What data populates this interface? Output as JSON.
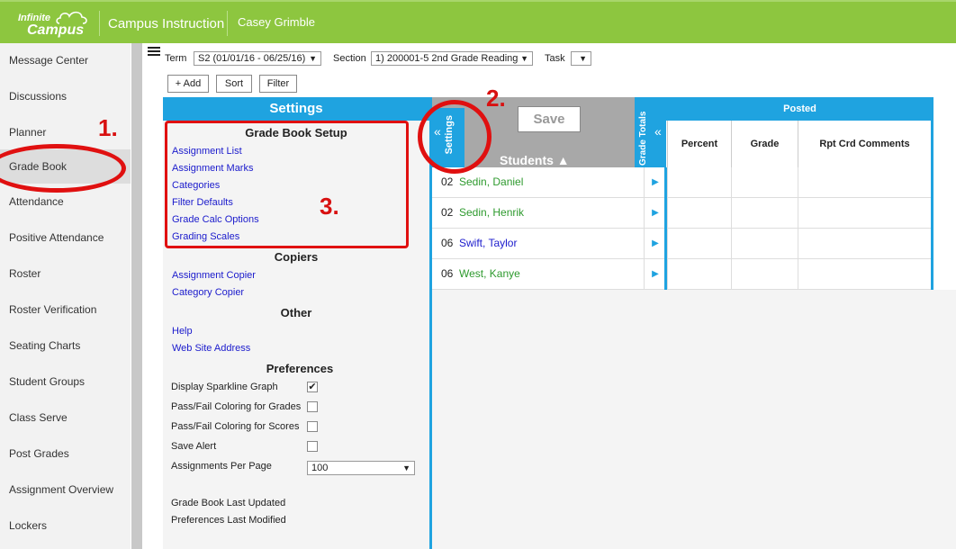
{
  "app": {
    "brand_line1": "Infinite",
    "brand_line2": "Campus",
    "title": "Campus Instruction",
    "user": "Casey Grimble"
  },
  "sidebar": {
    "items": [
      {
        "label": "Message Center"
      },
      {
        "label": "Discussions"
      },
      {
        "label": "Planner"
      },
      {
        "label": "Grade Book",
        "active": true
      },
      {
        "label": "Attendance"
      },
      {
        "label": "Positive Attendance"
      },
      {
        "label": "Roster"
      },
      {
        "label": "Roster Verification"
      },
      {
        "label": "Seating Charts"
      },
      {
        "label": "Student Groups"
      },
      {
        "label": "Class Serve"
      },
      {
        "label": "Post Grades"
      },
      {
        "label": "Assignment Overview"
      },
      {
        "label": "Lockers"
      }
    ]
  },
  "toolbar": {
    "term_label": "Term",
    "term_value": "S2 (01/01/16 - 06/25/16)",
    "section_label": "Section",
    "section_value": "1) 200001-5 2nd Grade Reading",
    "task_label": "Task",
    "task_value": "",
    "add_label": "+ Add",
    "sort_label": "Sort",
    "filter_label": "Filter"
  },
  "settings": {
    "header": "Settings",
    "setup_title": "Grade Book Setup",
    "setup_links": [
      "Assignment List",
      "Assignment Marks",
      "Categories",
      "Filter Defaults",
      "Grade Calc Options",
      "Grading Scales"
    ],
    "copiers_title": "Copiers",
    "copier_links": [
      "Assignment Copier",
      "Category Copier"
    ],
    "other_title": "Other",
    "other_links": [
      "Help",
      "Web Site Address"
    ],
    "prefs_title": "Preferences",
    "prefs": [
      {
        "label": "Display Sparkline Graph",
        "checked": true
      },
      {
        "label": "Pass/Fail Coloring for Grades",
        "checked": false
      },
      {
        "label": "Pass/Fail Coloring for Scores",
        "checked": false
      },
      {
        "label": "Save Alert",
        "checked": false
      }
    ],
    "per_page_label": "Assignments Per Page",
    "per_page_value": "100",
    "last_updated_label": "Grade Book Last Updated",
    "prefs_modified_label": "Preferences Last Modified"
  },
  "grid": {
    "settings_tab": "Settings",
    "save_label": "Save",
    "students_header": "Students ▲",
    "grade_totals_tab": "Grade Totals",
    "posted_header": "Posted",
    "columns": [
      "Percent",
      "Grade",
      "Rpt Crd Comments"
    ],
    "rows": [
      {
        "num": "02",
        "name": "Sedin, Daniel",
        "color": "#2e9a2e"
      },
      {
        "num": "02",
        "name": "Sedin, Henrik",
        "color": "#2e9a2e"
      },
      {
        "num": "06",
        "name": "Swift, Taylor",
        "color": "#1a1acc"
      },
      {
        "num": "06",
        "name": "West, Kanye",
        "color": "#2e9a2e"
      }
    ]
  },
  "annotations": {
    "step1": "1.",
    "step2": "2.",
    "step3": "3."
  },
  "colors": {
    "brand_green": "#8dc63f",
    "accent_blue": "#1fa3e0",
    "annotation_red": "#e01010"
  }
}
